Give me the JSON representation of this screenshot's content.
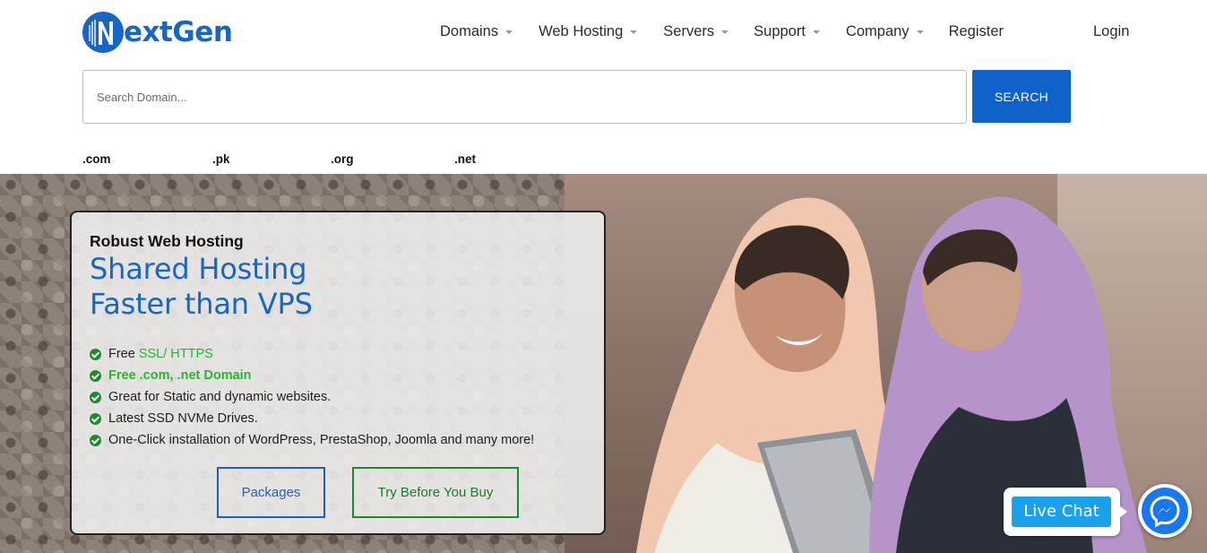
{
  "brand": {
    "logo_letter": "N",
    "logo_rest_1": "ext",
    "logo_rest_2": "Gen",
    "color": "#1766c6"
  },
  "nav": {
    "items": [
      {
        "label": "Domains",
        "dropdown": true
      },
      {
        "label": "Web Hosting",
        "dropdown": true
      },
      {
        "label": "Servers",
        "dropdown": true
      },
      {
        "label": "Support",
        "dropdown": true
      },
      {
        "label": "Company",
        "dropdown": true
      },
      {
        "label": "Register",
        "dropdown": false
      }
    ],
    "login_label": "Login"
  },
  "search": {
    "placeholder": "Search Domain...",
    "value": "",
    "button_label": "SEARCH",
    "button_color": "#0f62c9"
  },
  "tlds": [
    ".com",
    ".pk",
    ".org",
    ".net"
  ],
  "hero": {
    "eyebrow": "Robust Web Hosting",
    "headline_line1": "Shared Hosting",
    "headline_line2": "Faster than VPS",
    "features": [
      {
        "prefix": "Free ",
        "highlight": "SSL/ HTTPS",
        "suffix": ""
      },
      {
        "prefix": "",
        "highlight": "Free .com, .net Domain",
        "suffix": ""
      },
      {
        "prefix": "Great for Static and dynamic websites.",
        "highlight": "",
        "suffix": ""
      },
      {
        "prefix": "Latest SSD NVMe Drives.",
        "highlight": "",
        "suffix": ""
      },
      {
        "prefix": "One-Click installation of WordPress, PrestaShop, Joomla and many more!",
        "highlight": "",
        "suffix": ""
      }
    ],
    "packages_label": "Packages",
    "try_label": "Try Before You Buy",
    "check_icon": "check-circle-icon",
    "accent_green": "#2ab32e"
  },
  "chat": {
    "live_chat_label": "Live Chat",
    "messenger_icon": "messenger-icon"
  }
}
